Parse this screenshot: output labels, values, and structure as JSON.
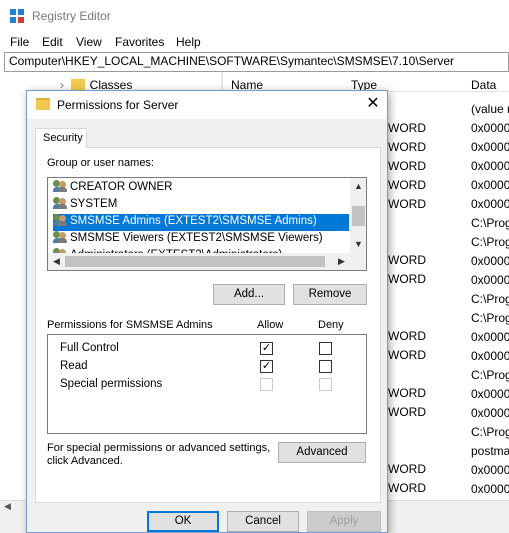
{
  "app": {
    "title": "Registry Editor"
  },
  "menu": [
    "File",
    "Edit",
    "View",
    "Favorites",
    "Help"
  ],
  "address": "Computer\\HKEY_LOCAL_MACHINE\\SOFTWARE\\Symantec\\SMSMSE\\7.10\\Server",
  "tree": {
    "item": "Classes"
  },
  "list": {
    "columns": {
      "name": "Name",
      "type": "Type",
      "data": "Data"
    },
    "type_rows": [
      "WORD",
      "WORD",
      "WORD",
      "WORD",
      "WORD",
      "WORD",
      "WORD",
      "WORD",
      "WORD",
      "WORD",
      "WORD",
      "WORD",
      "WORD",
      "WORD"
    ],
    "data_rows": [
      "(value n",
      "0x00000",
      "0x00000",
      "0x00000",
      "0x00000",
      "0x00000",
      "C:\\Prog",
      "C:\\Prog",
      "0x00000",
      "0x00000",
      "C:\\Prog",
      "C:\\Prog",
      "0x00000",
      "0x00000",
      "C:\\Prog",
      "0x00000",
      "0x00000",
      "C:\\Prog",
      "postma",
      "0x00000",
      "0x00000"
    ]
  },
  "dialog": {
    "title": "Permissions for Server",
    "tab": "Security",
    "group_label": "Group or user names:",
    "users": [
      "CREATOR OWNER",
      "SYSTEM",
      "SMSMSE Admins (EXTEST2\\SMSMSE Admins)",
      "SMSMSE Viewers (EXTEST2\\SMSMSE Viewers)",
      "Administrators (EXTEST2\\Administrators)"
    ],
    "add_label": "Add...",
    "remove_label": "Remove",
    "perm_header": "Permissions for SMSMSE Admins",
    "allow_label": "Allow",
    "deny_label": "Deny",
    "permissions": [
      {
        "name": "Full Control",
        "allow": true,
        "deny": false
      },
      {
        "name": "Read",
        "allow": true,
        "deny": false
      },
      {
        "name": "Special permissions",
        "allow": false,
        "deny": false
      }
    ],
    "advanced_text": "For special permissions or advanced settings, click Advanced.",
    "advanced_line1": "For special permissions or advanced settings,",
    "advanced_line2": "click Advanced.",
    "advanced_label": "Advanced",
    "ok_label": "OK",
    "cancel_label": "Cancel",
    "apply_label": "Apply"
  }
}
